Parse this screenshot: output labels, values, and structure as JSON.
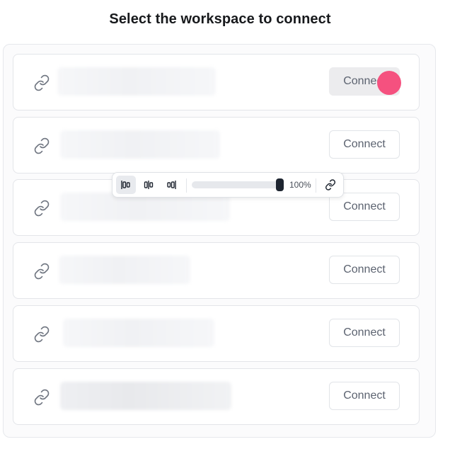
{
  "page": {
    "title": "Select the workspace to connect"
  },
  "workspaces": [
    {
      "connect_label": "Connect",
      "hovered": true
    },
    {
      "connect_label": "Connect",
      "hovered": false
    },
    {
      "connect_label": "Connect",
      "hovered": false
    },
    {
      "connect_label": "Connect",
      "hovered": false
    },
    {
      "connect_label": "Connect",
      "hovered": false
    },
    {
      "connect_label": "Connect",
      "hovered": false
    }
  ],
  "toolbar": {
    "buttons": [
      {
        "icon": "align-left-icon",
        "active": true
      },
      {
        "icon": "align-center-icon",
        "active": false
      },
      {
        "icon": "align-right-icon",
        "active": false
      }
    ],
    "zoom_percent": 100,
    "zoom_label": "100%",
    "link_icon": "link-icon"
  },
  "colors": {
    "cursor": "#f5517f",
    "slider_handle": "#1e2530",
    "button_hover_bg": "#ececee"
  },
  "icons": {
    "row_icon": "link-icon"
  }
}
